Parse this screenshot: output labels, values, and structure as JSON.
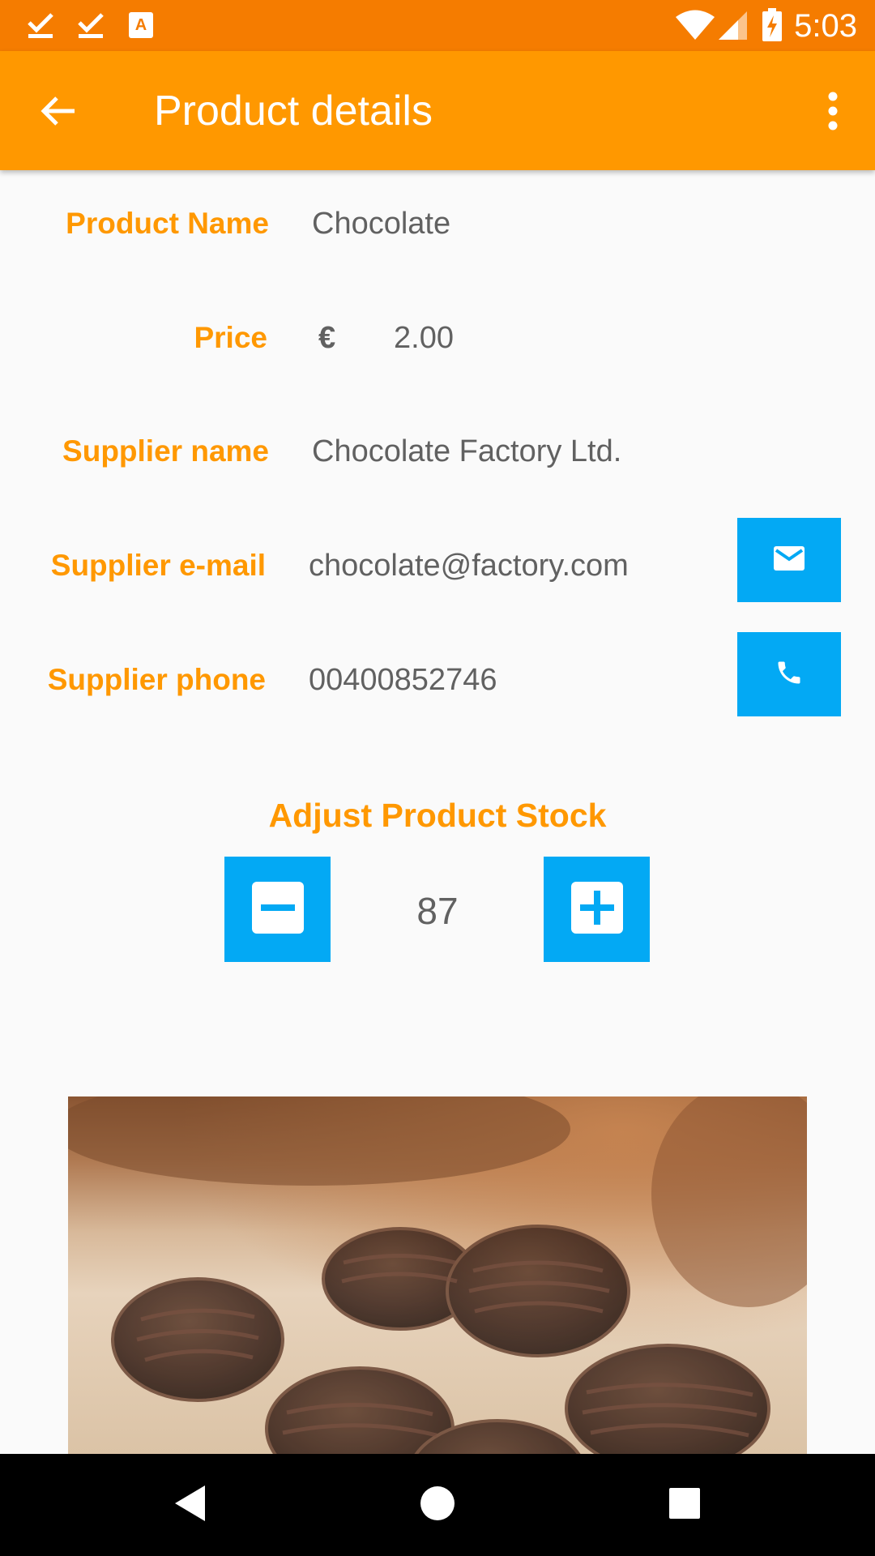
{
  "status_bar": {
    "time": "5:03",
    "icons": [
      "check-download-icon",
      "check-download-icon",
      "keyboard-a-icon",
      "wifi-icon",
      "signal-icon",
      "battery-charging-icon"
    ]
  },
  "app_bar": {
    "title": "Product details",
    "back_icon": "arrow-back-icon",
    "menu_icon": "more-vert-icon"
  },
  "details": {
    "product_name_label": "Product Name",
    "product_name": "Chocolate",
    "price_label": "Price",
    "currency": "€",
    "price": "2.00",
    "supplier_name_label": "Supplier name",
    "supplier_name": "Chocolate Factory Ltd.",
    "supplier_email_label": "Supplier e-mail",
    "supplier_email": "chocolate@factory.com",
    "supplier_phone_label": "Supplier phone",
    "supplier_phone": "00400852746"
  },
  "stock": {
    "title": "Adjust Product Stock",
    "quantity": "87"
  },
  "colors": {
    "status_bar": "#f57c00",
    "app_bar": "#ff9800",
    "label": "#ff9800",
    "value": "#616161",
    "button": "#03a9f4",
    "background": "#fafafa"
  }
}
